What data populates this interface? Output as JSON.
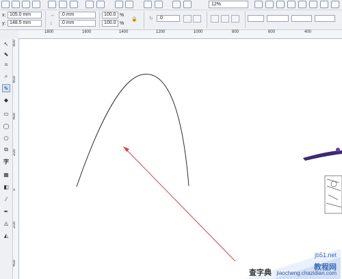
{
  "standard_toolbar": {
    "zoom_level": "12%"
  },
  "property_bar": {
    "x_label": "x:",
    "x_value": "105.0 mm",
    "y_label": "y:",
    "y_value": "148.5 mm",
    "width_value": ".0 mm",
    "height_value": ".0 mm",
    "scale_x": "100.0",
    "scale_y": "100.0",
    "percent": "%",
    "rotation": ".0"
  },
  "ruler_h_ticks": [
    "1800",
    "1600",
    "1400",
    "1200",
    "1000",
    "800",
    "600",
    "400"
  ],
  "ruler_v_ticks": [
    "800",
    "600",
    "400",
    "200",
    "0",
    "200",
    "400"
  ],
  "toolbox": {
    "text_tool_glyph": "字"
  },
  "watermark": {
    "left_text": "查字典",
    "right_text": "教程网",
    "domain_text": "jb51.net",
    "url_text": "jiaocheng.chazidian.com"
  },
  "colors": {
    "curve": "#2b2b2b",
    "arrow": "#d84040",
    "accent": "#3c6ab8"
  }
}
